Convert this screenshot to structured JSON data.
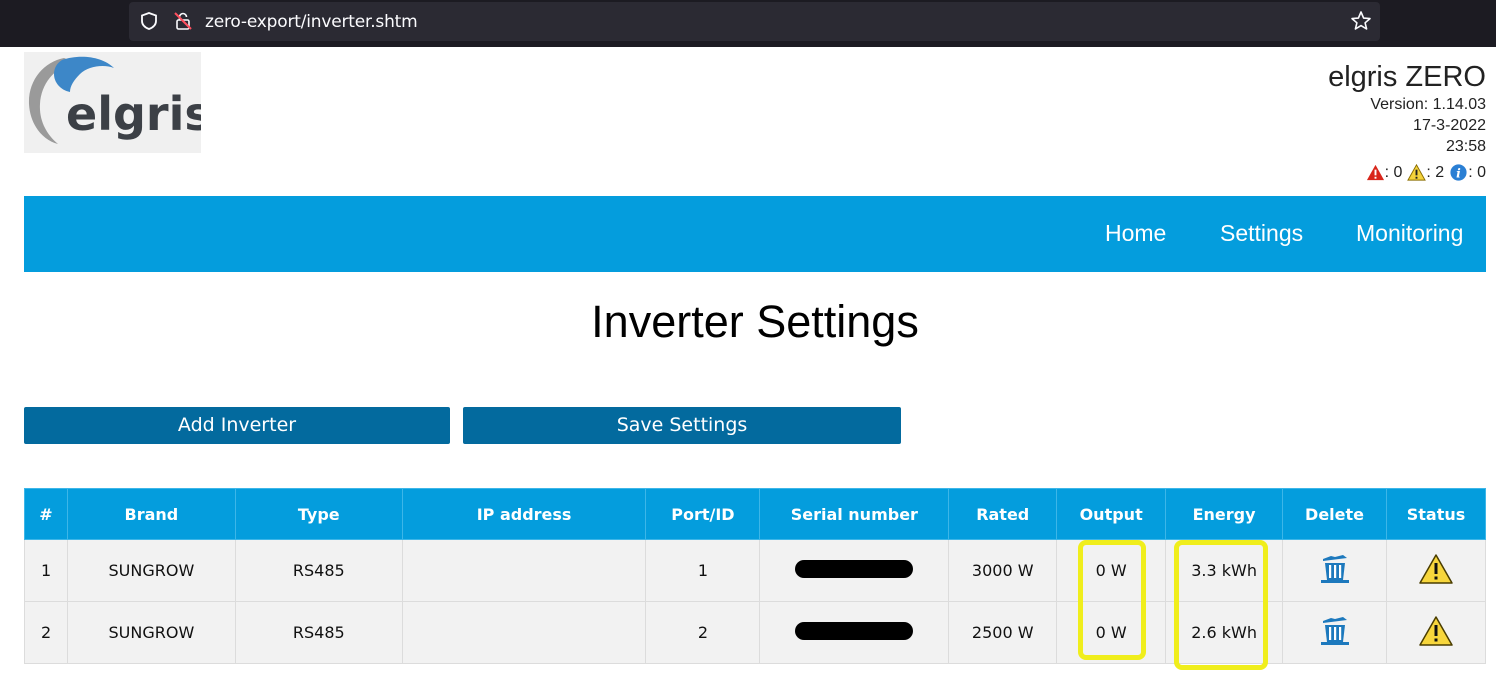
{
  "browser": {
    "url": "zero-export/inverter.shtm"
  },
  "header": {
    "product_name": "elgris ZERO",
    "version": "Version: 1.14.03",
    "date": "17-3-2022",
    "time": "23:58",
    "alerts": {
      "errors": ": 0",
      "warnings": ": 2",
      "info": ": 0"
    }
  },
  "logo_text": "elgris",
  "nav": {
    "home": "Home",
    "settings": "Settings",
    "monitoring": "Monitoring"
  },
  "page_title": "Inverter Settings",
  "buttons": {
    "add": "Add Inverter",
    "save": "Save Settings"
  },
  "table": {
    "headers": [
      "#",
      "Brand",
      "Type",
      "IP address",
      "Port/ID",
      "Serial number",
      "Rated",
      "Output",
      "Energy",
      "Delete",
      "Status"
    ],
    "rows": [
      {
        "num": "1",
        "brand": "SUNGROW",
        "type": "RS485",
        "ip": "",
        "port": "1",
        "serial": "",
        "rated": "3000 W",
        "output": "0 W",
        "energy": "3.3 kWh"
      },
      {
        "num": "2",
        "brand": "SUNGROW",
        "type": "RS485",
        "ip": "",
        "port": "2",
        "serial": "",
        "rated": "2500 W",
        "output": "0 W",
        "energy": "2.6 kWh"
      }
    ]
  },
  "colors": {
    "nav": "#049ddd",
    "button": "#036a9e",
    "highlight": "#f0ee1c"
  }
}
